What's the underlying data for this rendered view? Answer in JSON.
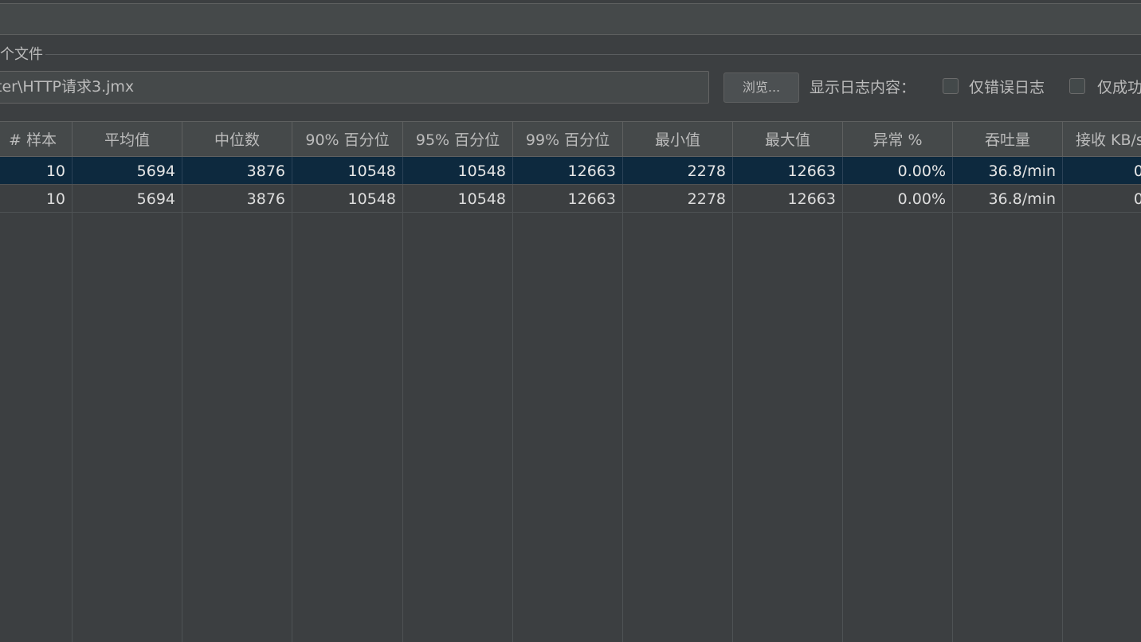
{
  "group": {
    "legend": "个文件",
    "filename_value": "ter\\HTTP请求3.jmx",
    "browse_label": "浏览...",
    "log_label": "显示日志内容：",
    "errors_only_label": "仅错误日志",
    "success_only_label": "仅成功"
  },
  "table": {
    "columns": [
      "# 样本",
      "平均值",
      "中位数",
      "90% 百分位",
      "95% 百分位",
      "99% 百分位",
      "最小值",
      "最大值",
      "异常 %",
      "吞吐量",
      "接收 KB/s"
    ],
    "rows": [
      [
        "10",
        "5694",
        "3876",
        "10548",
        "10548",
        "12663",
        "2278",
        "12663",
        "0.00%",
        "36.8/min",
        "0"
      ],
      [
        "10",
        "5694",
        "3876",
        "10548",
        "10548",
        "12663",
        "2278",
        "12663",
        "0.00%",
        "36.8/min",
        "0"
      ]
    ],
    "selected_row": 0
  },
  "colors": {
    "background": "#3c3f41",
    "header_background": "#45494a",
    "selected_row": "#0d293e",
    "grid": "#4e5254"
  }
}
